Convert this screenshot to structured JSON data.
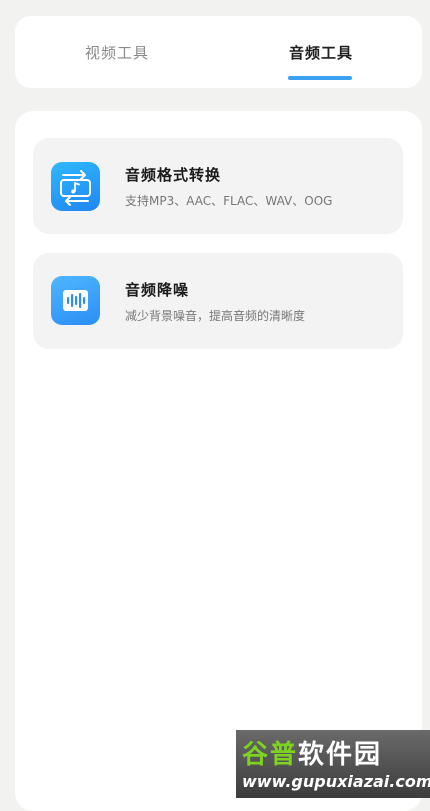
{
  "tabs": [
    {
      "label": "视频工具",
      "active": false
    },
    {
      "label": "音频工具",
      "active": true
    }
  ],
  "accent_color": "#3aa0f0",
  "tools": [
    {
      "title": "音频格式转换",
      "description": "支持MP3、AAC、FLAC、WAV、OOG",
      "icon": "audio-convert-icon"
    },
    {
      "title": "音频降噪",
      "description": "减少背景噪音，提高音频的清晰度",
      "icon": "noise-reduction-icon"
    }
  ],
  "watermark": {
    "logo_part1": "谷普",
    "logo_part2": "软件园",
    "url": "www.gupuxiazai.com"
  }
}
